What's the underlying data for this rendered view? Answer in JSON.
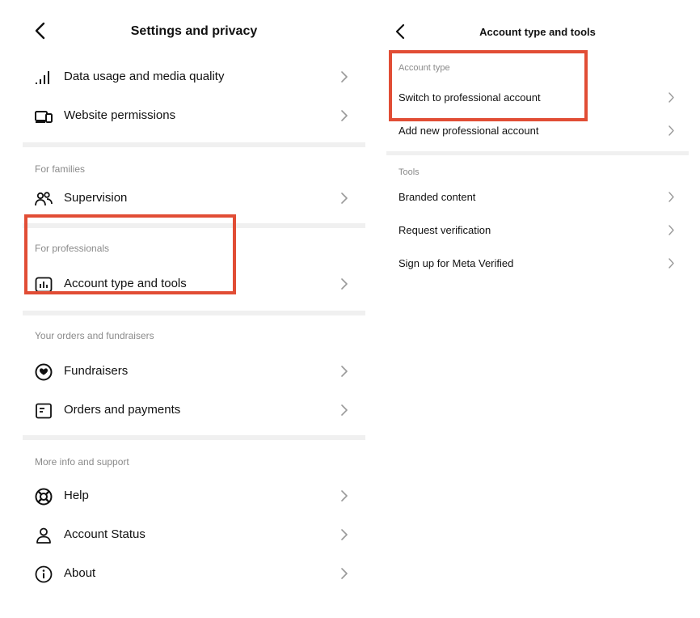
{
  "left": {
    "title": "Settings and privacy",
    "top_items": [
      {
        "label": "Data usage and media quality",
        "icon": "signal-bars-icon"
      },
      {
        "label": "Website permissions",
        "icon": "devices-icon"
      }
    ],
    "families": {
      "header": "For families",
      "item": {
        "label": "Supervision",
        "icon": "people-icon"
      }
    },
    "professionals": {
      "header": "For professionals",
      "item": {
        "label": "Account type and tools",
        "icon": "chart-box-icon"
      }
    },
    "orders": {
      "header": "Your orders and fundraisers",
      "items": [
        {
          "label": "Fundraisers",
          "icon": "fundraiser-icon"
        },
        {
          "label": "Orders and payments",
          "icon": "receipt-icon"
        }
      ]
    },
    "support": {
      "header": "More info and support",
      "items": [
        {
          "label": "Help",
          "icon": "lifebuoy-icon"
        },
        {
          "label": "Account Status",
          "icon": "person-icon"
        },
        {
          "label": "About",
          "icon": "info-icon"
        }
      ]
    }
  },
  "right": {
    "title": "Account type and tools",
    "account_type": {
      "header": "Account type",
      "items": [
        "Switch to professional account",
        "Add new professional account"
      ]
    },
    "tools": {
      "header": "Tools",
      "items": [
        "Branded content",
        "Request verification",
        "Sign up for Meta Verified"
      ]
    }
  },
  "colors": {
    "highlight": "#e14d35",
    "divider": "#f0f0f0",
    "section_text": "#8a8a8a",
    "chevron": "#9a9a9a"
  }
}
